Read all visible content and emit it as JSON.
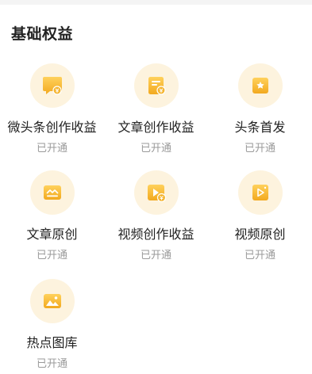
{
  "section": {
    "title": "基础权益"
  },
  "items": [
    {
      "label": "微头条创作收益",
      "status": "已开通",
      "icon": "micro-headline-revenue-icon"
    },
    {
      "label": "文章创作收益",
      "status": "已开通",
      "icon": "article-revenue-icon"
    },
    {
      "label": "头条首发",
      "status": "已开通",
      "icon": "headline-first-publish-icon"
    },
    {
      "label": "文章原创",
      "status": "已开通",
      "icon": "article-original-icon"
    },
    {
      "label": "视频创作收益",
      "status": "已开通",
      "icon": "video-revenue-icon"
    },
    {
      "label": "视频原创",
      "status": "已开通",
      "icon": "video-original-icon"
    },
    {
      "label": "热点图库",
      "status": "已开通",
      "icon": "hot-image-library-icon"
    }
  ],
  "colors": {
    "icon_gradient_top": "#ffd15c",
    "icon_gradient_bottom": "#f2a91f",
    "icon_bg": "#fdf3de"
  }
}
